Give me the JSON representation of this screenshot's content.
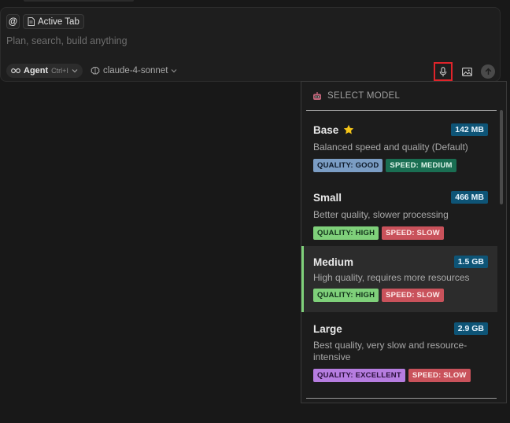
{
  "composer": {
    "at_label": "@",
    "active_tab_label": "Active Tab",
    "placeholder": "Plan, search, build anything",
    "agent_label": "Agent",
    "agent_shortcut": "Ctrl+I",
    "model_label": "claude-4-sonnet"
  },
  "dropdown": {
    "header": "SELECT MODEL",
    "items": [
      {
        "name": "Base",
        "size": "142 MB",
        "desc": "Balanced speed and quality (Default)",
        "quality": "QUALITY: GOOD",
        "speed": "SPEED: MEDIUM",
        "starred": true
      },
      {
        "name": "Small",
        "size": "466 MB",
        "desc": "Better quality, slower processing",
        "quality": "QUALITY: HIGH",
        "speed": "SPEED: SLOW"
      },
      {
        "name": "Medium",
        "size": "1.5 GB",
        "desc": "High quality, requires more resources",
        "quality": "QUALITY: HIGH",
        "speed": "SPEED: SLOW",
        "selected": true
      },
      {
        "name": "Large",
        "size": "2.9 GB",
        "desc": "Best quality, very slow and resource-intensive",
        "quality": "QUALITY: EXCELLENT",
        "speed": "SPEED: SLOW"
      }
    ]
  },
  "colors": {
    "background": "#181818",
    "highlight_border": "#e0242a",
    "selected_accent": "#7fd07a",
    "size_badge": "#0e5476"
  },
  "icons": [
    "file-icon",
    "infinity-icon",
    "chevron-down-icon",
    "brain-icon",
    "microphone-icon",
    "image-icon",
    "arrow-up-icon",
    "robot-icon",
    "star-icon"
  ]
}
